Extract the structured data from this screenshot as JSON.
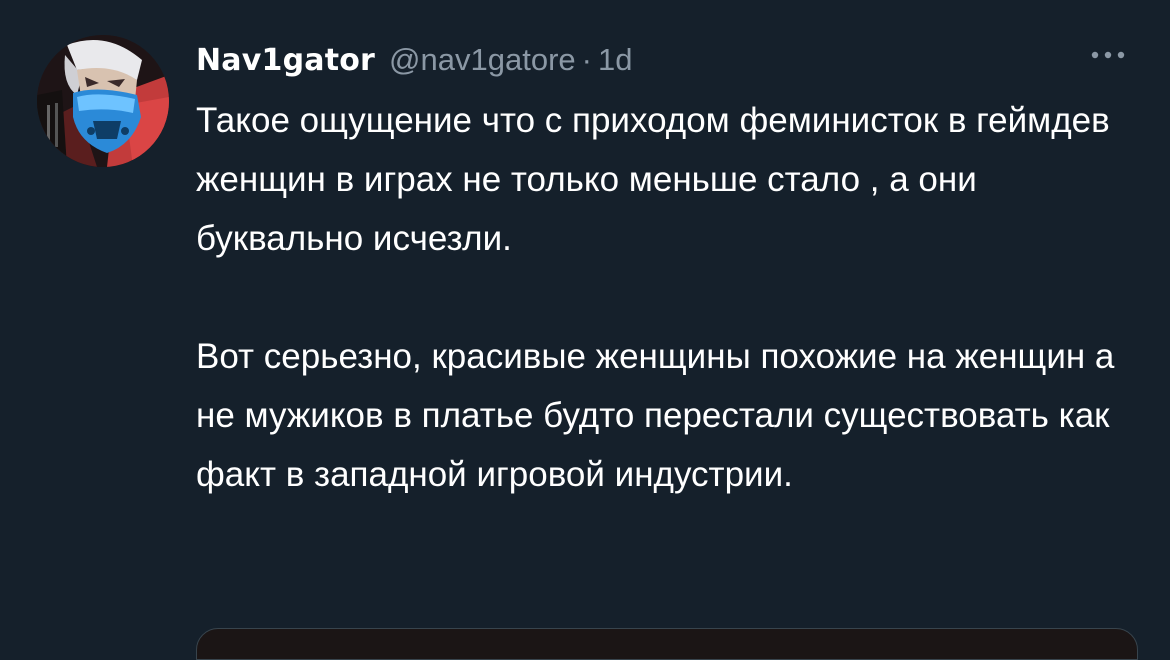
{
  "tweet": {
    "author": {
      "display_name": "Nav1gator",
      "handle": "@nav1gatore",
      "avatar_icon": "masked-character-avatar-icon"
    },
    "separator": "·",
    "time": "1d",
    "more_icon": "more-dots-icon",
    "paragraphs": [
      "Такое ощущение что с приходом феминисток в геймдев женщин в играх не только меньше стало , а они буквально исчезли.",
      "Вот серьезно, красивые женщины похожие на женщин а не мужиков в платье будто перестали существовать как факт в западной игровой индустрии."
    ]
  },
  "colors": {
    "background": "#15202b",
    "primary_text": "#ffffff",
    "secondary_text": "#8b98a5"
  }
}
